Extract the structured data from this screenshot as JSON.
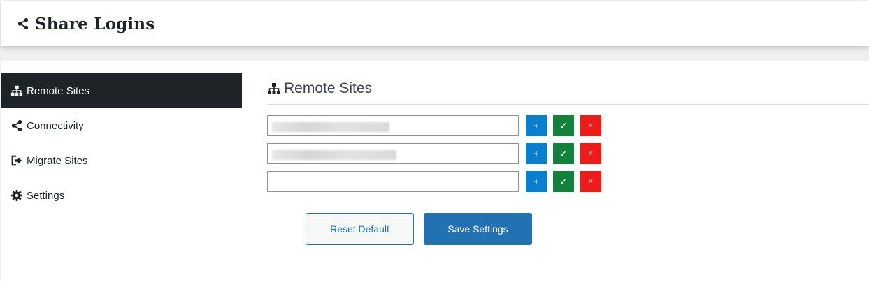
{
  "header": {
    "title": "Share Logins",
    "icon": "share-icon"
  },
  "sidebar": {
    "items": [
      {
        "label": "Remote Sites",
        "icon": "sitemap-icon",
        "active": true
      },
      {
        "label": "Connectivity",
        "icon": "share-icon",
        "active": false
      },
      {
        "label": "Migrate Sites",
        "icon": "sign-out-icon",
        "active": false
      },
      {
        "label": "Settings",
        "icon": "gear-icon",
        "active": false
      }
    ]
  },
  "main": {
    "title": "Remote Sites",
    "title_icon": "sitemap-icon",
    "rows": [
      {
        "value": "",
        "blurred": true
      },
      {
        "value": "",
        "blurred": true
      },
      {
        "value": "",
        "blurred": false
      }
    ],
    "row_buttons": {
      "add": "+",
      "confirm": "✓",
      "remove": "×"
    },
    "reset_label": "Reset Default",
    "save_label": "Save Settings"
  },
  "colors": {
    "sidebar_active_bg": "#1d2327",
    "add_button": "#0a7fcf",
    "confirm_button": "#13803b",
    "remove_button": "#ee1b1b",
    "primary": "#2271b1"
  }
}
